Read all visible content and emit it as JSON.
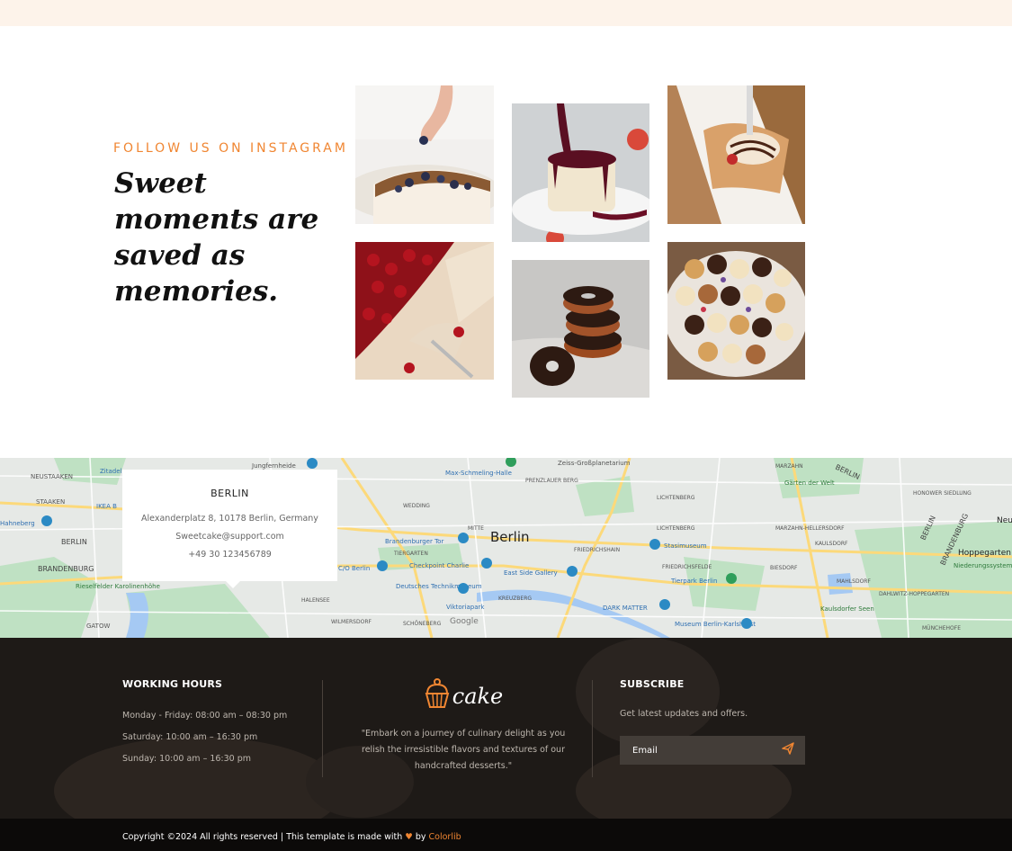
{
  "instagram": {
    "kicker": "FOLLOW US ON INSTAGRAM",
    "title": "Sweet moments are saved as memories.",
    "photos": [
      "cake-with-blueberries",
      "cheesecake-berry-sauce",
      "ice-cream-cone",
      "cherry-pie",
      "chocolate-donuts",
      "cupcake-platter"
    ]
  },
  "map": {
    "card": {
      "city": "BERLIN",
      "address": "Alexanderplatz 8, 10178 Berlin, Germany",
      "email": "Sweetcake@support.com",
      "phone": "+49 30 123456789"
    },
    "labels": {
      "center": "Berlin",
      "brandenburger_tor": "Brandenburger Tor",
      "checkpoint": "Checkpoint Charlie",
      "east_side": "East Side Gallery",
      "stasimuseum": "Stasimuseum",
      "tierpark": "Tierpark Berlin",
      "technik": "Deutsches Technikmuseum",
      "viktoria": "Viktoriapark",
      "dark_matter": "DARK MATTER",
      "museum": "Museum Berlin-Karlshorst",
      "co_berlin": "C/O Berlin",
      "max_schmeling": "Max-Schmeling-Halle",
      "zeiss": "Zeiss-Großplanetarium",
      "ikea": "IKEA B",
      "zitadelle": "Zitadel",
      "jungfernheide": "Jungfernheide",
      "hoppegarten": "Hoppegarten",
      "kaulsdorfer": "Kaulsdorfer Seen",
      "karolinenhohe": "Rieselfelder Karolinenhöhe",
      "neustaaken": "NEUSTAAKEN",
      "staaken": "STAAKEN",
      "hahneberg": "Hahneberg",
      "berlin_w": "BERLIN",
      "brandenburg_w": "BRANDENBURG",
      "gatow": "GATOW",
      "halensee": "HALENSEE",
      "wilmersdorf": "WILMERSDORF",
      "schoneberg": "SCHÖNEBERG",
      "kreuzberg": "KREUZBERG",
      "tiergarten": "TIERGARTEN",
      "mitte": "MITTE",
      "wedding": "WEDDING",
      "prenzlauer": "PRENZLAUER BERG",
      "friedrichshain": "FRIEDRICHSHAIN",
      "lichtenberg": "LICHTENBERG",
      "friedrichsfelde": "FRIEDRICHSFELDE",
      "biesdorf": "BIESDORF",
      "marzahn": "MARZAHN",
      "marzahn_h": "MARZAHN-HELLERSDORF",
      "kaulsdorf": "KAULSDORF",
      "mahlsdorf": "MAHLSDORF",
      "dahlwitz": "DAHLWITZ-HOPPEGARTEN",
      "munchehofe": "MÜNCHEHOFE",
      "honower": "HONOWER SIEDLUNG",
      "garten": "Gärten der Welt",
      "berlin_e": "BERLIN",
      "brandenburg_e": "BRANDENBURG",
      "berlin_ne": "BERLIN",
      "neu": "Neu",
      "niederung": "Niederungssystem des Neuenhagener...",
      "google": "Google"
    }
  },
  "footer": {
    "hours": {
      "heading": "WORKING HOURS",
      "lines": [
        "Monday - Friday: 08:00 am – 08:30 pm",
        "Saturday: 10:00 am – 16:30 pm",
        "Sunday: 10:00 am – 16:30 pm"
      ]
    },
    "logo_text": "cake",
    "quote": "\"Embark on a journey of culinary delight as you relish the irresistible flavors and textures of our handcrafted desserts.\"",
    "subscribe": {
      "heading": "SUBSCRIBE",
      "text": "Get latest updates and offers.",
      "placeholder": "Email"
    }
  },
  "copyright": {
    "text": "Copyright ©2024 All rights reserved | This template is made with ",
    "by": " by ",
    "link": "Colorlib"
  },
  "colors": {
    "accent": "#f08632",
    "footer_bg": "#1e1a17",
    "topband": "#fdf3ea"
  }
}
